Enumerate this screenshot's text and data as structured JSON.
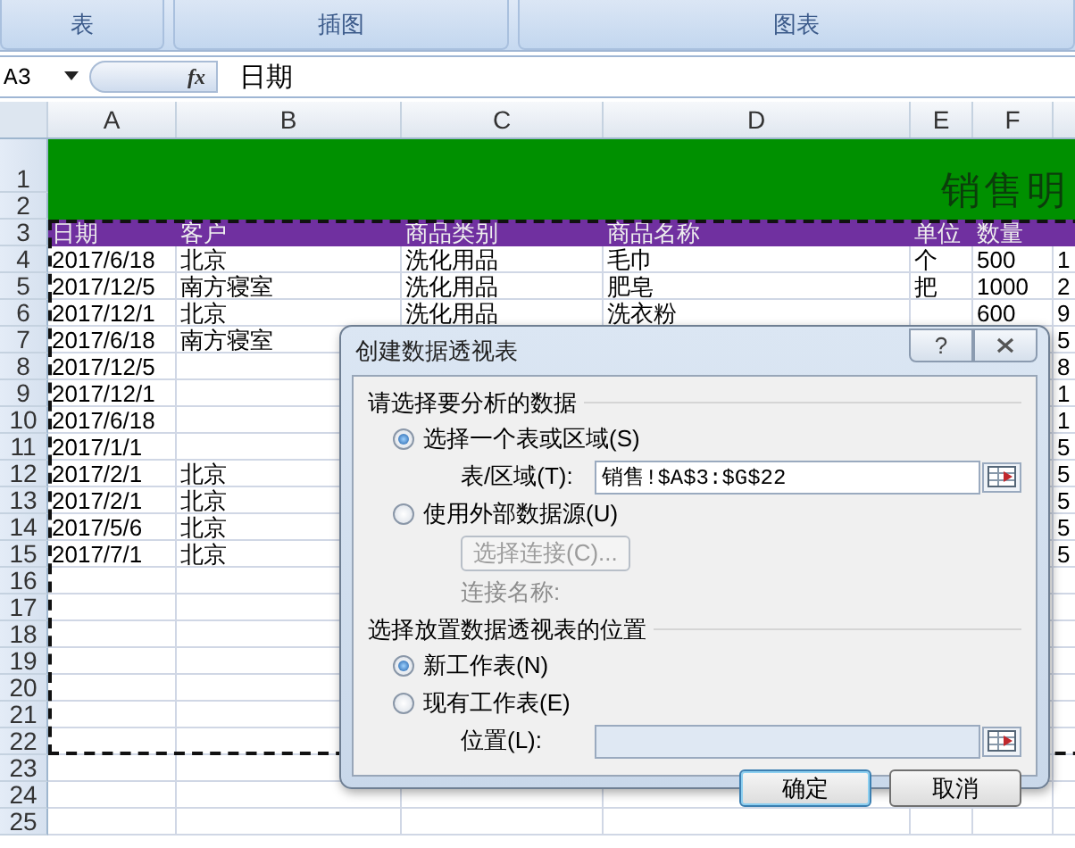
{
  "ribbon": {
    "groups": [
      "表",
      "插图",
      "图表"
    ]
  },
  "formula_bar": {
    "name_box": "A3",
    "function_symbol": "fx",
    "value": "日期"
  },
  "columns": [
    "A",
    "B",
    "C",
    "D",
    "E",
    "F"
  ],
  "title_rows": {
    "numbers": [
      "1",
      "2"
    ],
    "title": "销售明"
  },
  "header_row": {
    "number": "3",
    "cells": [
      "日期",
      "客户",
      "商品类别",
      "商品名称",
      "单位",
      "数量"
    ]
  },
  "rows": [
    {
      "number": "4",
      "date": "2017/6/18",
      "customer": "北京",
      "category": "洗化用品",
      "product": "毛巾",
      "unit": "个",
      "qty": "500",
      "col_g": "1"
    },
    {
      "number": "5",
      "date": "2017/12/5",
      "customer": "南方寝室",
      "category": "洗化用品",
      "product": "肥皂",
      "unit": "把",
      "qty": "1000",
      "col_g": "2"
    },
    {
      "number": "6",
      "date": "2017/12/1",
      "customer": "北京",
      "category": "洗化用品",
      "product": "洗衣粉",
      "qty": "600",
      "col_g": "9"
    },
    {
      "number": "7",
      "date": "2017/6/18",
      "customer": "南方寝室",
      "col_g": "5"
    },
    {
      "number": "8",
      "date": "2017/12/5",
      "col_g": "8"
    },
    {
      "number": "9",
      "date": "2017/12/1",
      "col_g": "1"
    },
    {
      "number": "10",
      "date": "2017/6/18",
      "col_g": "1"
    },
    {
      "number": "11",
      "date": "2017/1/1",
      "col_g": "5"
    },
    {
      "number": "12",
      "date": "2017/2/1",
      "customer": "北京",
      "col_g": "5"
    },
    {
      "number": "13",
      "date": "2017/2/1",
      "customer": "北京",
      "col_g": "5"
    },
    {
      "number": "14",
      "date": "2017/5/6",
      "customer": "北京",
      "col_g": "5"
    },
    {
      "number": "15",
      "date": "2017/7/1",
      "customer": "北京",
      "col_g": "5"
    },
    {
      "number": "16"
    },
    {
      "number": "17"
    },
    {
      "number": "18"
    },
    {
      "number": "19"
    },
    {
      "number": "20"
    },
    {
      "number": "21"
    },
    {
      "number": "22"
    },
    {
      "number": "23"
    },
    {
      "number": "24"
    },
    {
      "number": "25"
    }
  ],
  "dialog": {
    "title": "创建数据透视表",
    "help": "?",
    "sections": [
      {
        "label": "请选择要分析的数据",
        "items": [
          {
            "kind": "radio",
            "label": "选择一个表或区域(S)",
            "selected": true
          },
          {
            "kind": "field",
            "label": "表/区域(T):",
            "value": "销售!$A$3:$G$22",
            "disabled": false
          },
          {
            "kind": "radio",
            "label": "使用外部数据源(U)",
            "selected": false
          },
          {
            "kind": "button",
            "label": "选择连接(C)...",
            "disabled": true
          },
          {
            "kind": "text",
            "label": "连接名称:",
            "disabled": true
          }
        ]
      },
      {
        "label": "选择放置数据透视表的位置",
        "items": [
          {
            "kind": "radio",
            "label": "新工作表(N)",
            "selected": true
          },
          {
            "kind": "radio",
            "label": "现有工作表(E)",
            "selected": false
          },
          {
            "kind": "field",
            "label": "位置(L):",
            "disabled": true
          }
        ]
      }
    ],
    "buttons": [
      {
        "label": "确定",
        "default": true
      },
      {
        "label": "取消",
        "default": false
      }
    ]
  }
}
